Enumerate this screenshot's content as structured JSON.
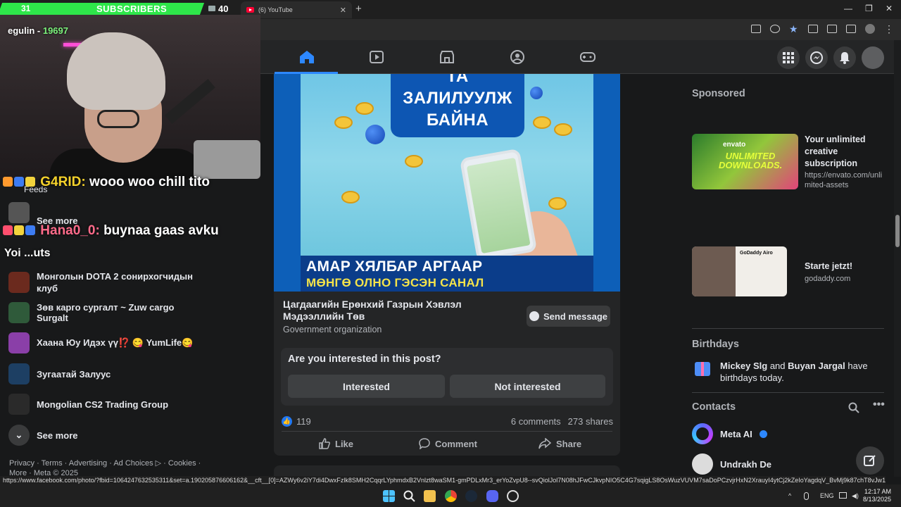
{
  "overlay": {
    "sub_count_left": "31",
    "sub_label": "SUBSCRIBERS",
    "sub_count_right": "40",
    "streamer_name": "egulin - ",
    "streamer_suffix": "19697"
  },
  "browser": {
    "tab_title": "(6) YouTube"
  },
  "chat": [
    {
      "user": "G4RID:",
      "message": "wooo woo chill tito"
    },
    {
      "user": "Hana0_0:",
      "message": "buynaa gaas avku"
    }
  ],
  "left_nav": {
    "feeds": "Feeds",
    "see_more_top": "See more",
    "shortcuts_heading": "Yoi  ...uts",
    "groups": [
      {
        "label": "Монголын DOTA 2 сонирхогчидын клуб",
        "color": "#6b2a1e"
      },
      {
        "label": "Зөв карго сургалт ~ Zuw cargo Surgalt",
        "color": "#2f5a3a"
      },
      {
        "label": "Хаана Юу Идэх үү⁉️ 😋 YumLife😋",
        "color": "#8a3fa8"
      },
      {
        "label": "Зугаатай Залуус",
        "color": "#1d3f63"
      },
      {
        "label": "Mongolian CS2 Trading Group",
        "color": "#2a2a2a"
      }
    ],
    "see_more_bottom": "See more",
    "footer": "Privacy · Terms · Advertising · Ad Choices ▷ · Cookies · More · Meta © 2025"
  },
  "post": {
    "image_headline": "ТА\nЗАЛИЛУУЛЖ\nБАЙНА",
    "image_line1": "АМАР ХЯЛБАР АРГААР",
    "image_line2": "МӨНГӨ ОЛНО ГЭСЭН САНАЛ",
    "page_name": "Цагдаагийн Ерөнхий Газрын Хэвлэл Мэдээллийн Төв",
    "page_category": "Government organization",
    "send_message": "Send message",
    "interest_question": "Are you interested in this post?",
    "interested": "Interested",
    "not_interested": "Not interested",
    "likes": "119",
    "comments": "6 comments",
    "shares": "273 shares",
    "like": "Like",
    "comment": "Comment",
    "share": "Share"
  },
  "sidebar": {
    "sponsored": "Sponsored",
    "ads": [
      {
        "title": "Your unlimited creative subscription",
        "url": "https://envato.com/unlimited-assets",
        "img_text": "UNLIMITED DOWNLOADS.",
        "brand": "envato"
      },
      {
        "title": "Starte jetzt!",
        "url": "godaddy.com",
        "img_text": "GoDaddy Airo",
        "brand": "GoDaddy"
      }
    ],
    "birthdays_heading": "Birthdays",
    "birthday_name1": "Mickey Slg",
    "birthday_and": " and ",
    "birthday_name2": "Buyan Jargal",
    "birthday_tail": " have birthdays today.",
    "contacts_heading": "Contacts",
    "contacts": [
      {
        "name": "Meta AI"
      },
      {
        "name": "Undrakh De"
      }
    ]
  },
  "status": {
    "url": "https://www.facebook.com/photo/?fbid=1064247632535311&set=a.190205876606162&__cft__[0]=AZWy6v2iY7di4DwxFzlk8SMH2CqqrLYphmdxB2Vnlzt8waSM1-gmPDLxMr3_erYoZvpU8--svQiolJol7N08hJFwCJkvpNIO5C4G7sqigLS8OsWuzVUVM7saDoPCzvjrHxN2XrauyI4ytCj2kZeIoYagdqV_BvMj9k87chT8vJw1XaBVUrDAbTWLALH8z1pKw5x3q0yC6jK8VS_..."
  },
  "taskbar": {
    "lang": "ENG",
    "time": "12:17 AM",
    "date": "8/13/2025"
  }
}
